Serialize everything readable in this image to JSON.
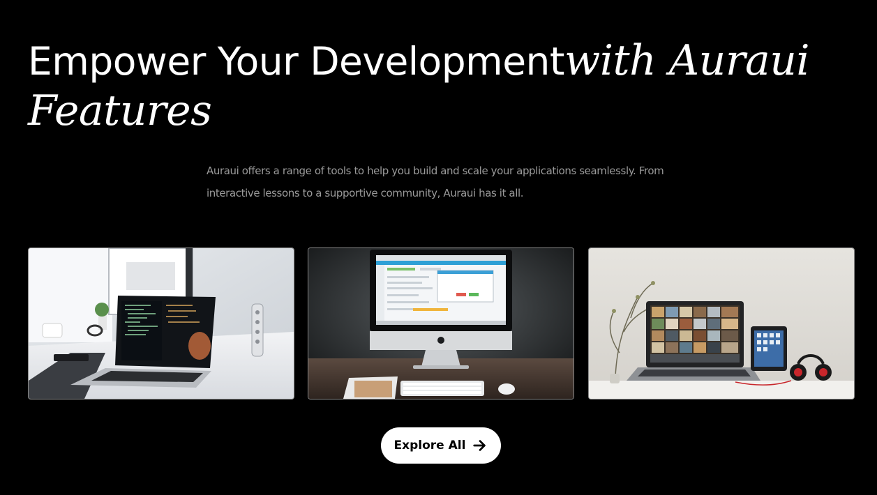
{
  "hero": {
    "heading_plain": "Empower Your Development",
    "heading_accent": "with Auraui Features",
    "description": "Auraui offers a range of tools to help you build and scale your applications seamlessly. From interactive lessons to a supportive community, Auraui has it all."
  },
  "cards": [
    {
      "image": "laptop-with-code-on-desk-photo"
    },
    {
      "image": "imac-on-desk-photo"
    },
    {
      "image": "laptop-tablet-headphones-photo"
    }
  ],
  "cta": {
    "label": "Explore All",
    "icon": "arrow-right-icon"
  },
  "colors": {
    "background": "#000000",
    "heading": "#ffffff",
    "description": "#9a9a9a",
    "button_bg": "#ffffff",
    "button_text": "#000000"
  }
}
